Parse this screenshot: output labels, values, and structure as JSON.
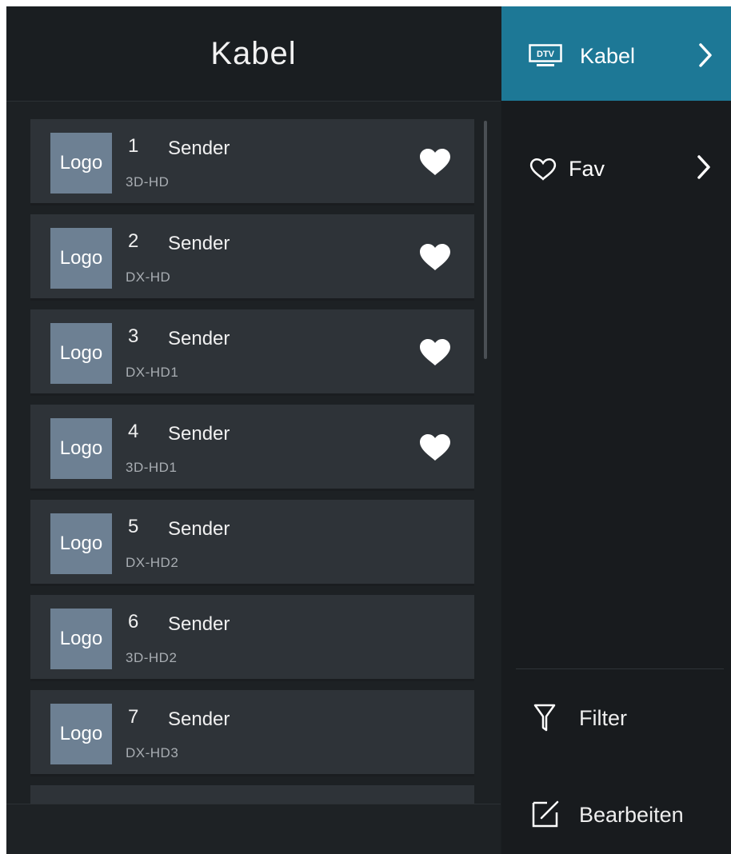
{
  "header": {
    "title": "Kabel"
  },
  "channels": [
    {
      "logo": "Logo",
      "number": "1",
      "name": "Sender",
      "sub": "3D-HD",
      "favorite": true
    },
    {
      "logo": "Logo",
      "number": "2",
      "name": "Sender",
      "sub": "DX-HD",
      "favorite": true
    },
    {
      "logo": "Logo",
      "number": "3",
      "name": "Sender",
      "sub": "DX-HD1",
      "favorite": true
    },
    {
      "logo": "Logo",
      "number": "4",
      "name": "Sender",
      "sub": "3D-HD1",
      "favorite": true
    },
    {
      "logo": "Logo",
      "number": "5",
      "name": "Sender",
      "sub": "DX-HD2",
      "favorite": false
    },
    {
      "logo": "Logo",
      "number": "6",
      "name": "Sender",
      "sub": "3D-HD2",
      "favorite": false
    },
    {
      "logo": "Logo",
      "number": "7",
      "name": "Sender",
      "sub": "DX-HD3",
      "favorite": false
    }
  ],
  "sidebar": {
    "items": [
      {
        "label": "Kabel",
        "icon": "dtv-icon",
        "selected": true
      },
      {
        "label": "Fav",
        "icon": "heart-outline-icon",
        "selected": false
      }
    ],
    "tools": [
      {
        "label": "Filter",
        "icon": "filter-icon"
      },
      {
        "label": "Bearbeiten",
        "icon": "edit-icon"
      }
    ],
    "dtv_icon_text": "DTV"
  },
  "colors": {
    "accent": "#1d7896",
    "background": "#1d2124",
    "row": "#2e3338",
    "logo": "#6d8093"
  }
}
